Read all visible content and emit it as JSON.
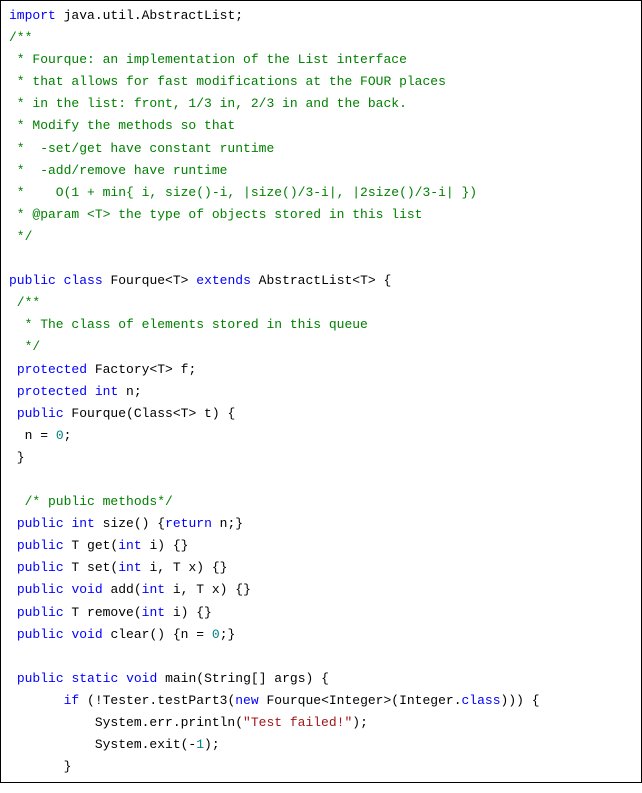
{
  "lines": [
    {
      "tokens": [
        {
          "t": "import",
          "c": "kw"
        },
        {
          "t": " java.util.AbstractList;",
          "c": "plain"
        }
      ]
    },
    {
      "tokens": [
        {
          "t": "/**",
          "c": "comment"
        }
      ]
    },
    {
      "tokens": [
        {
          "t": " * Fourque: an implementation of the List interface",
          "c": "comment"
        }
      ]
    },
    {
      "tokens": [
        {
          "t": " * that allows for fast modifications at the FOUR places",
          "c": "comment"
        }
      ]
    },
    {
      "tokens": [
        {
          "t": " * in the list: front, 1/3 in, 2/3 in and the back.",
          "c": "comment"
        }
      ]
    },
    {
      "tokens": [
        {
          "t": " * Modify the methods so that",
          "c": "comment"
        }
      ]
    },
    {
      "tokens": [
        {
          "t": " *  -set/get have constant runtime",
          "c": "comment"
        }
      ]
    },
    {
      "tokens": [
        {
          "t": " *  -add/remove have runtime",
          "c": "comment"
        }
      ]
    },
    {
      "tokens": [
        {
          "t": " *    O(1 + min{ i, size()-i, |size()/3-i|, |2size()/3-i| })",
          "c": "comment"
        }
      ]
    },
    {
      "tokens": [
        {
          "t": " * @param <T> the type of objects stored in this list",
          "c": "comment"
        }
      ]
    },
    {
      "tokens": [
        {
          "t": " */",
          "c": "comment"
        }
      ]
    },
    {
      "tokens": []
    },
    {
      "tokens": [
        {
          "t": "public",
          "c": "kw"
        },
        {
          "t": " ",
          "c": "plain"
        },
        {
          "t": "class",
          "c": "kw"
        },
        {
          "t": " Fourque<T> ",
          "c": "plain"
        },
        {
          "t": "extends",
          "c": "kw"
        },
        {
          "t": " AbstractList<T> {",
          "c": "plain"
        }
      ]
    },
    {
      "tokens": [
        {
          "t": " /**",
          "c": "comment"
        }
      ]
    },
    {
      "tokens": [
        {
          "t": "  * The class of elements stored in this queue",
          "c": "comment"
        }
      ]
    },
    {
      "tokens": [
        {
          "t": "  */",
          "c": "comment"
        }
      ]
    },
    {
      "tokens": [
        {
          "t": " ",
          "c": "plain"
        },
        {
          "t": "protected",
          "c": "kw"
        },
        {
          "t": " Factory<T> f;",
          "c": "plain"
        }
      ]
    },
    {
      "tokens": [
        {
          "t": " ",
          "c": "plain"
        },
        {
          "t": "protected",
          "c": "kw"
        },
        {
          "t": " ",
          "c": "plain"
        },
        {
          "t": "int",
          "c": "kw"
        },
        {
          "t": " n;",
          "c": "plain"
        }
      ]
    },
    {
      "tokens": [
        {
          "t": " ",
          "c": "plain"
        },
        {
          "t": "public",
          "c": "kw"
        },
        {
          "t": " Fourque(Class<T> t) {",
          "c": "plain"
        }
      ]
    },
    {
      "tokens": [
        {
          "t": "  n = ",
          "c": "plain"
        },
        {
          "t": "0",
          "c": "num"
        },
        {
          "t": ";",
          "c": "plain"
        }
      ]
    },
    {
      "tokens": [
        {
          "t": " }",
          "c": "plain"
        }
      ]
    },
    {
      "tokens": []
    },
    {
      "tokens": [
        {
          "t": "  /* public methods*/",
          "c": "comment"
        }
      ]
    },
    {
      "tokens": [
        {
          "t": " ",
          "c": "plain"
        },
        {
          "t": "public",
          "c": "kw"
        },
        {
          "t": " ",
          "c": "plain"
        },
        {
          "t": "int",
          "c": "kw"
        },
        {
          "t": " size() {",
          "c": "plain"
        },
        {
          "t": "return",
          "c": "kw"
        },
        {
          "t": " n;}",
          "c": "plain"
        }
      ]
    },
    {
      "tokens": [
        {
          "t": " ",
          "c": "plain"
        },
        {
          "t": "public",
          "c": "kw"
        },
        {
          "t": " T get(",
          "c": "plain"
        },
        {
          "t": "int",
          "c": "kw"
        },
        {
          "t": " i) {}",
          "c": "plain"
        }
      ]
    },
    {
      "tokens": [
        {
          "t": " ",
          "c": "plain"
        },
        {
          "t": "public",
          "c": "kw"
        },
        {
          "t": " T set(",
          "c": "plain"
        },
        {
          "t": "int",
          "c": "kw"
        },
        {
          "t": " i, T x) {}",
          "c": "plain"
        }
      ]
    },
    {
      "tokens": [
        {
          "t": " ",
          "c": "plain"
        },
        {
          "t": "public",
          "c": "kw"
        },
        {
          "t": " ",
          "c": "plain"
        },
        {
          "t": "void",
          "c": "kw"
        },
        {
          "t": " add(",
          "c": "plain"
        },
        {
          "t": "int",
          "c": "kw"
        },
        {
          "t": " i, T x) {}",
          "c": "plain"
        }
      ]
    },
    {
      "tokens": [
        {
          "t": " ",
          "c": "plain"
        },
        {
          "t": "public",
          "c": "kw"
        },
        {
          "t": " T remove(",
          "c": "plain"
        },
        {
          "t": "int",
          "c": "kw"
        },
        {
          "t": " i) {}",
          "c": "plain"
        }
      ]
    },
    {
      "tokens": [
        {
          "t": " ",
          "c": "plain"
        },
        {
          "t": "public",
          "c": "kw"
        },
        {
          "t": " ",
          "c": "plain"
        },
        {
          "t": "void",
          "c": "kw"
        },
        {
          "t": " clear() {n = ",
          "c": "plain"
        },
        {
          "t": "0",
          "c": "num"
        },
        {
          "t": ";}",
          "c": "plain"
        }
      ]
    },
    {
      "tokens": []
    },
    {
      "tokens": [
        {
          "t": " ",
          "c": "plain"
        },
        {
          "t": "public",
          "c": "kw"
        },
        {
          "t": " ",
          "c": "plain"
        },
        {
          "t": "static",
          "c": "kw"
        },
        {
          "t": " ",
          "c": "plain"
        },
        {
          "t": "void",
          "c": "kw"
        },
        {
          "t": " main(String[] args) {",
          "c": "plain"
        }
      ]
    },
    {
      "tokens": [
        {
          "t": "       ",
          "c": "plain"
        },
        {
          "t": "if",
          "c": "kw"
        },
        {
          "t": " (!Tester.testPart3(",
          "c": "plain"
        },
        {
          "t": "new",
          "c": "kw"
        },
        {
          "t": " Fourque<Integer>(Integer.",
          "c": "plain"
        },
        {
          "t": "class",
          "c": "kw"
        },
        {
          "t": "))) {",
          "c": "plain"
        }
      ]
    },
    {
      "tokens": [
        {
          "t": "           System.err.println(",
          "c": "plain"
        },
        {
          "t": "\"Test failed!\"",
          "c": "str"
        },
        {
          "t": ");",
          "c": "plain"
        }
      ]
    },
    {
      "tokens": [
        {
          "t": "           System.exit(-",
          "c": "plain"
        },
        {
          "t": "1",
          "c": "num"
        },
        {
          "t": ");",
          "c": "plain"
        }
      ]
    },
    {
      "tokens": [
        {
          "t": "       }",
          "c": "plain"
        }
      ]
    }
  ]
}
